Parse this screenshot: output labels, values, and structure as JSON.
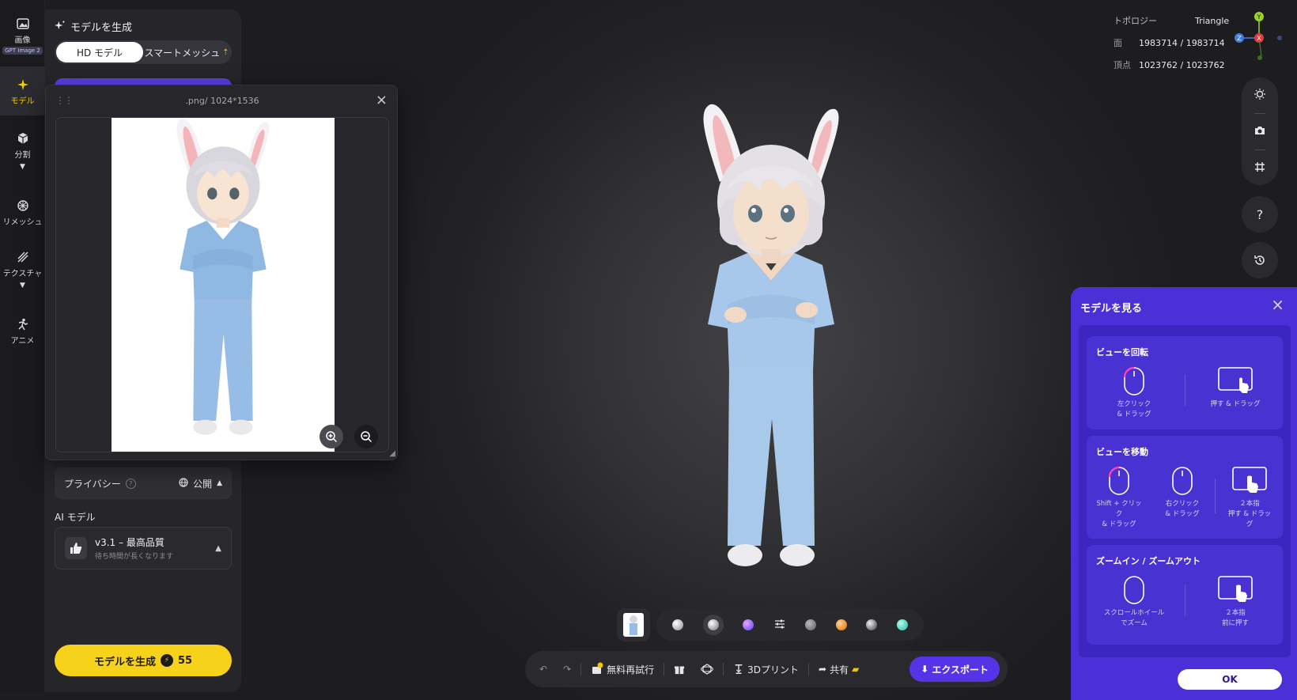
{
  "rail": {
    "image": {
      "label": "画像",
      "badge": "GPT Image 2"
    },
    "model": {
      "label": "モデル"
    },
    "split": {
      "label": "分割"
    },
    "remesh": {
      "label": "リメッシュ"
    },
    "texture": {
      "label": "テクスチャ"
    },
    "anime": {
      "label": "アニメ"
    }
  },
  "panel": {
    "title": "モデルを生成",
    "mode_hd": "HD モデル",
    "mode_smart": "スマートメッシュ",
    "privacy_label": "プライバシー",
    "privacy_value": "公開",
    "ai_label": "AI モデル",
    "ai_model_name": "v3.1 – 最高品質",
    "ai_model_note": "待ち時間が長くなります",
    "generate_label": "モデルを生成",
    "generate_cost": "55"
  },
  "popup": {
    "title": ".png/ 1024*1536"
  },
  "info": {
    "topology_label": "トポロジー",
    "topology_value": "Triangle",
    "faces_label": "面",
    "faces_value": "1983714 / 1983714",
    "verts_label": "頂点",
    "verts_value": "1023762 / 1023762"
  },
  "axis": {
    "y": "Y",
    "x": "X",
    "z": "Z"
  },
  "actions": {
    "retry": "無料再試行",
    "print": "3Dプリント",
    "share": "共有",
    "export": "エクスポート"
  },
  "help": {
    "title": "モデルを見る",
    "rotate_title": "ビューを回転",
    "rotate_left": "左クリック\n& ドラッグ",
    "rotate_touch": "押す & ドラッグ",
    "move_title": "ビューを移動",
    "move_shift": "Shift + クリッ\nク\n& ドラッグ",
    "move_right": "右クリック\n& ドラッグ",
    "move_touch": "２本指\n押す & ドラッ\nグ",
    "zoom_title": "ズームイン / ズームアウト",
    "zoom_wheel": "スクロールホイール\nでズーム",
    "zoom_touch": "２本指\n前に押す",
    "ok": "OK"
  },
  "colors": {
    "accent_yellow": "#f7d21b",
    "accent_purple": "#5534e8",
    "help_bg": "#4a30d6"
  }
}
